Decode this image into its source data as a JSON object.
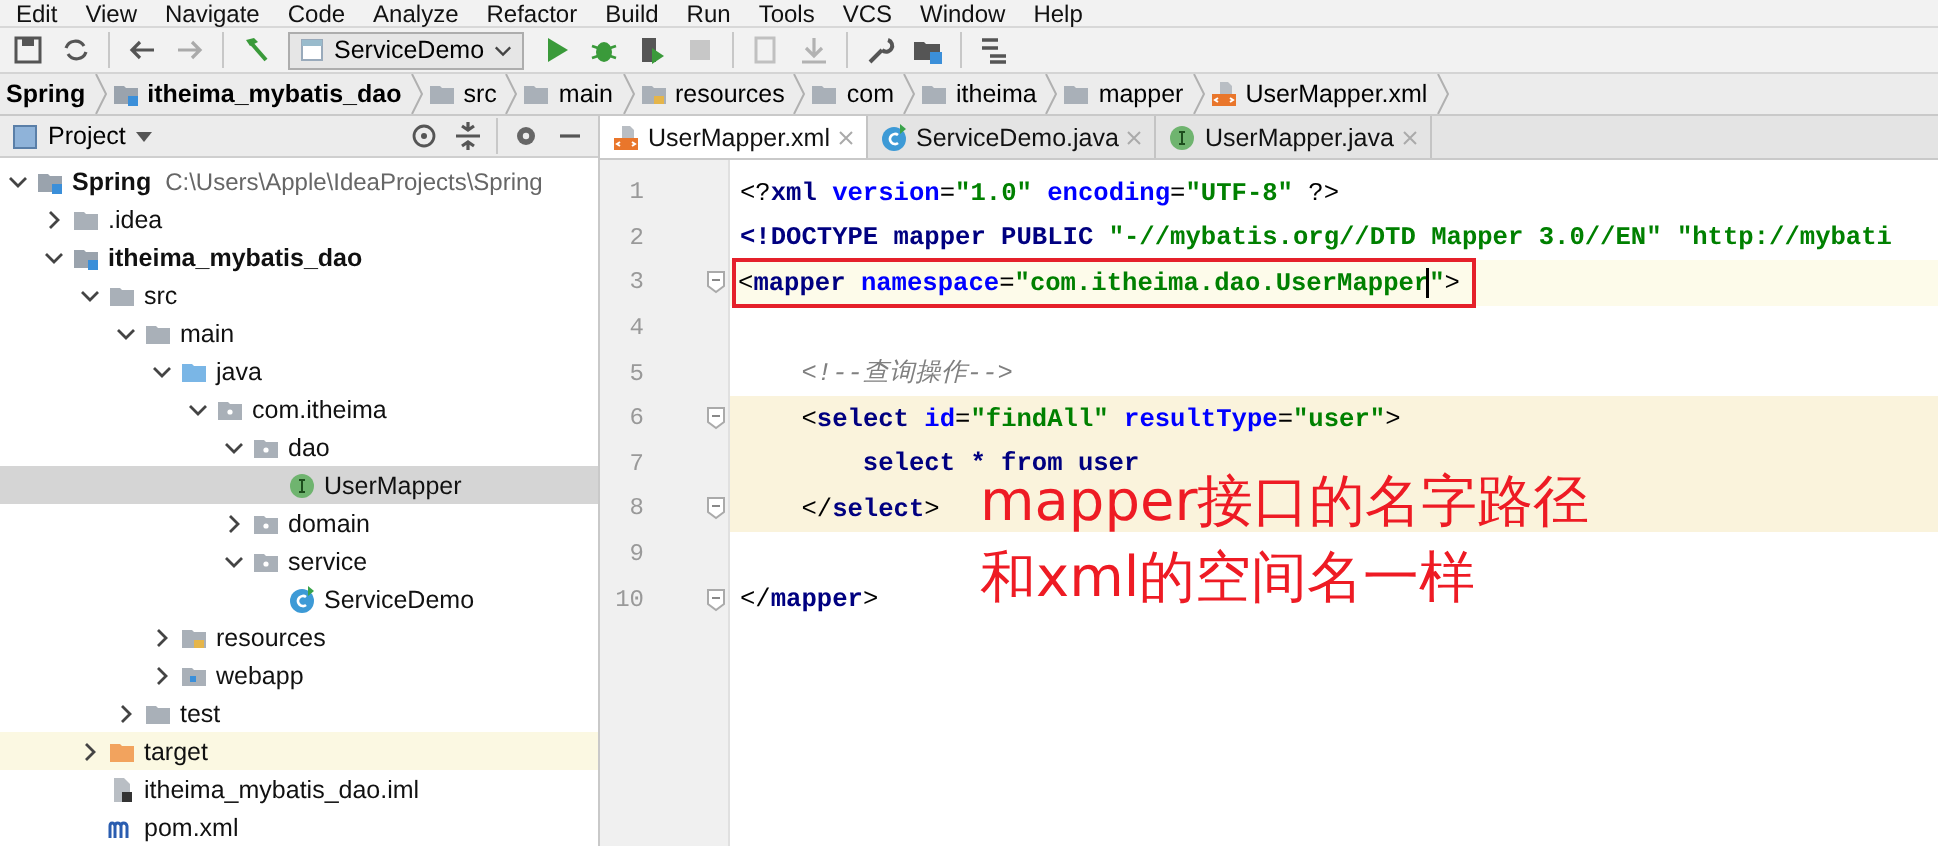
{
  "menu": [
    "Edit",
    "View",
    "Navigate",
    "Code",
    "Analyze",
    "Refactor",
    "Build",
    "Run",
    "Tools",
    "VCS",
    "Window",
    "Help"
  ],
  "toolbar": {
    "run_config": "ServiceDemo"
  },
  "breadcrumbs": [
    {
      "label": "Spring",
      "kind": "project"
    },
    {
      "label": "itheima_mybatis_dao",
      "kind": "module"
    },
    {
      "label": "src",
      "kind": "folder"
    },
    {
      "label": "main",
      "kind": "folder"
    },
    {
      "label": "resources",
      "kind": "resources"
    },
    {
      "label": "com",
      "kind": "folder"
    },
    {
      "label": "itheima",
      "kind": "folder"
    },
    {
      "label": "mapper",
      "kind": "folder"
    },
    {
      "label": "UserMapper.xml",
      "kind": "xml"
    }
  ],
  "project_panel": {
    "title": "Project",
    "tree": [
      {
        "label": "Spring",
        "path": "C:\\Users\\Apple\\IdeaProjects\\Spring",
        "kind": "module",
        "expanded": true,
        "selected": false,
        "children": [
          {
            "label": ".idea",
            "kind": "folder",
            "expanded": false,
            "selected": false
          },
          {
            "label": "itheima_mybatis_dao",
            "kind": "module",
            "expanded": true,
            "selected": false,
            "children": [
              {
                "label": "src",
                "kind": "folder",
                "expanded": true,
                "selected": false,
                "children": [
                  {
                    "label": "main",
                    "kind": "folder",
                    "expanded": true,
                    "selected": false,
                    "children": [
                      {
                        "label": "java",
                        "kind": "source",
                        "expanded": true,
                        "selected": false,
                        "children": [
                          {
                            "label": "com.itheima",
                            "kind": "package",
                            "expanded": true,
                            "selected": false,
                            "children": [
                              {
                                "label": "dao",
                                "kind": "package",
                                "expanded": true,
                                "selected": false,
                                "children": [
                                  {
                                    "label": "UserMapper",
                                    "kind": "interface",
                                    "selected": true
                                  }
                                ]
                              },
                              {
                                "label": "domain",
                                "kind": "package",
                                "expanded": false,
                                "selected": false
                              },
                              {
                                "label": "service",
                                "kind": "package",
                                "expanded": true,
                                "selected": false,
                                "children": [
                                  {
                                    "label": "ServiceDemo",
                                    "kind": "class",
                                    "selected": false
                                  }
                                ]
                              }
                            ]
                          }
                        ]
                      },
                      {
                        "label": "resources",
                        "kind": "resources",
                        "expanded": false,
                        "selected": false
                      },
                      {
                        "label": "webapp",
                        "kind": "webapp",
                        "expanded": false,
                        "selected": false
                      }
                    ]
                  },
                  {
                    "label": "test",
                    "kind": "folder",
                    "expanded": false,
                    "selected": false
                  }
                ]
              },
              {
                "label": "target",
                "kind": "excluded",
                "expanded": false,
                "selected": false
              },
              {
                "label": "itheima_mybatis_dao.iml",
                "kind": "iml",
                "selected": false
              },
              {
                "label": "pom.xml",
                "kind": "maven",
                "selected": false
              }
            ]
          }
        ]
      }
    ]
  },
  "editor_tabs": [
    {
      "label": "UserMapper.xml",
      "kind": "xml",
      "selected": true
    },
    {
      "label": "ServiceDemo.java",
      "kind": "class",
      "selected": false
    },
    {
      "label": "UserMapper.java",
      "kind": "interface",
      "selected": false
    }
  ],
  "code": [
    {
      "number": "1",
      "tokens": [
        {
          "text": "<?",
          "kind": "punct"
        },
        {
          "text": "xml ",
          "kind": "tag"
        },
        {
          "text": "version",
          "kind": "attr"
        },
        {
          "text": "=",
          "kind": "punct"
        },
        {
          "text": "\"1.0\" ",
          "kind": "value"
        },
        {
          "text": "encoding",
          "kind": "attr"
        },
        {
          "text": "=",
          "kind": "punct"
        },
        {
          "text": "\"UTF-8\" ",
          "kind": "value"
        },
        {
          "text": "?>",
          "kind": "punct"
        }
      ]
    },
    {
      "number": "2",
      "tokens": [
        {
          "text": "<!DOCTYPE mapper PUBLIC ",
          "kind": "tag"
        },
        {
          "text": "\"-//mybatis.org//DTD Mapper 3.0//EN\" \"http://mybati",
          "kind": "value"
        }
      ]
    },
    {
      "number": "3",
      "fold": true,
      "caret": true,
      "boxed": true,
      "tokens": [
        {
          "text": "<",
          "kind": "punct"
        },
        {
          "text": "mapper ",
          "kind": "tag"
        },
        {
          "text": "namespace",
          "kind": "attr"
        },
        {
          "text": "=",
          "kind": "punct"
        },
        {
          "text": "\"com.itheima.dao.UserMapper\"",
          "kind": "value"
        },
        {
          "text": ">",
          "kind": "punct"
        }
      ]
    },
    {
      "number": "4"
    },
    {
      "number": "5",
      "tokens": [
        {
          "text": "    <!--查询操作-->",
          "kind": "comment"
        }
      ]
    },
    {
      "number": "6",
      "fold": true,
      "highlighted": true,
      "tokens": [
        {
          "text": "    <",
          "kind": "punct"
        },
        {
          "text": "select ",
          "kind": "tag"
        },
        {
          "text": "id",
          "kind": "attr"
        },
        {
          "text": "=",
          "kind": "punct"
        },
        {
          "text": "\"findAll\" ",
          "kind": "value"
        },
        {
          "text": "resultType",
          "kind": "attr"
        },
        {
          "text": "=",
          "kind": "punct"
        },
        {
          "text": "\"user\"",
          "kind": "value"
        },
        {
          "text": ">",
          "kind": "punct"
        }
      ]
    },
    {
      "number": "7",
      "highlighted": true,
      "tokens": [
        {
          "text": "        select * from user",
          "kind": "sql"
        }
      ]
    },
    {
      "number": "8",
      "fold": true,
      "highlighted": true,
      "tokens": [
        {
          "text": "    </",
          "kind": "punct"
        },
        {
          "text": "select",
          "kind": "tag"
        },
        {
          "text": ">",
          "kind": "punct"
        }
      ]
    },
    {
      "number": "9"
    },
    {
      "number": "10",
      "fold": true,
      "tokens": [
        {
          "text": "</",
          "kind": "punct"
        },
        {
          "text": "mapper",
          "kind": "tag"
        },
        {
          "text": ">",
          "kind": "punct"
        }
      ]
    }
  ],
  "annotation": [
    "mapper接口的名字路径",
    "和xml的空间名一样"
  ]
}
